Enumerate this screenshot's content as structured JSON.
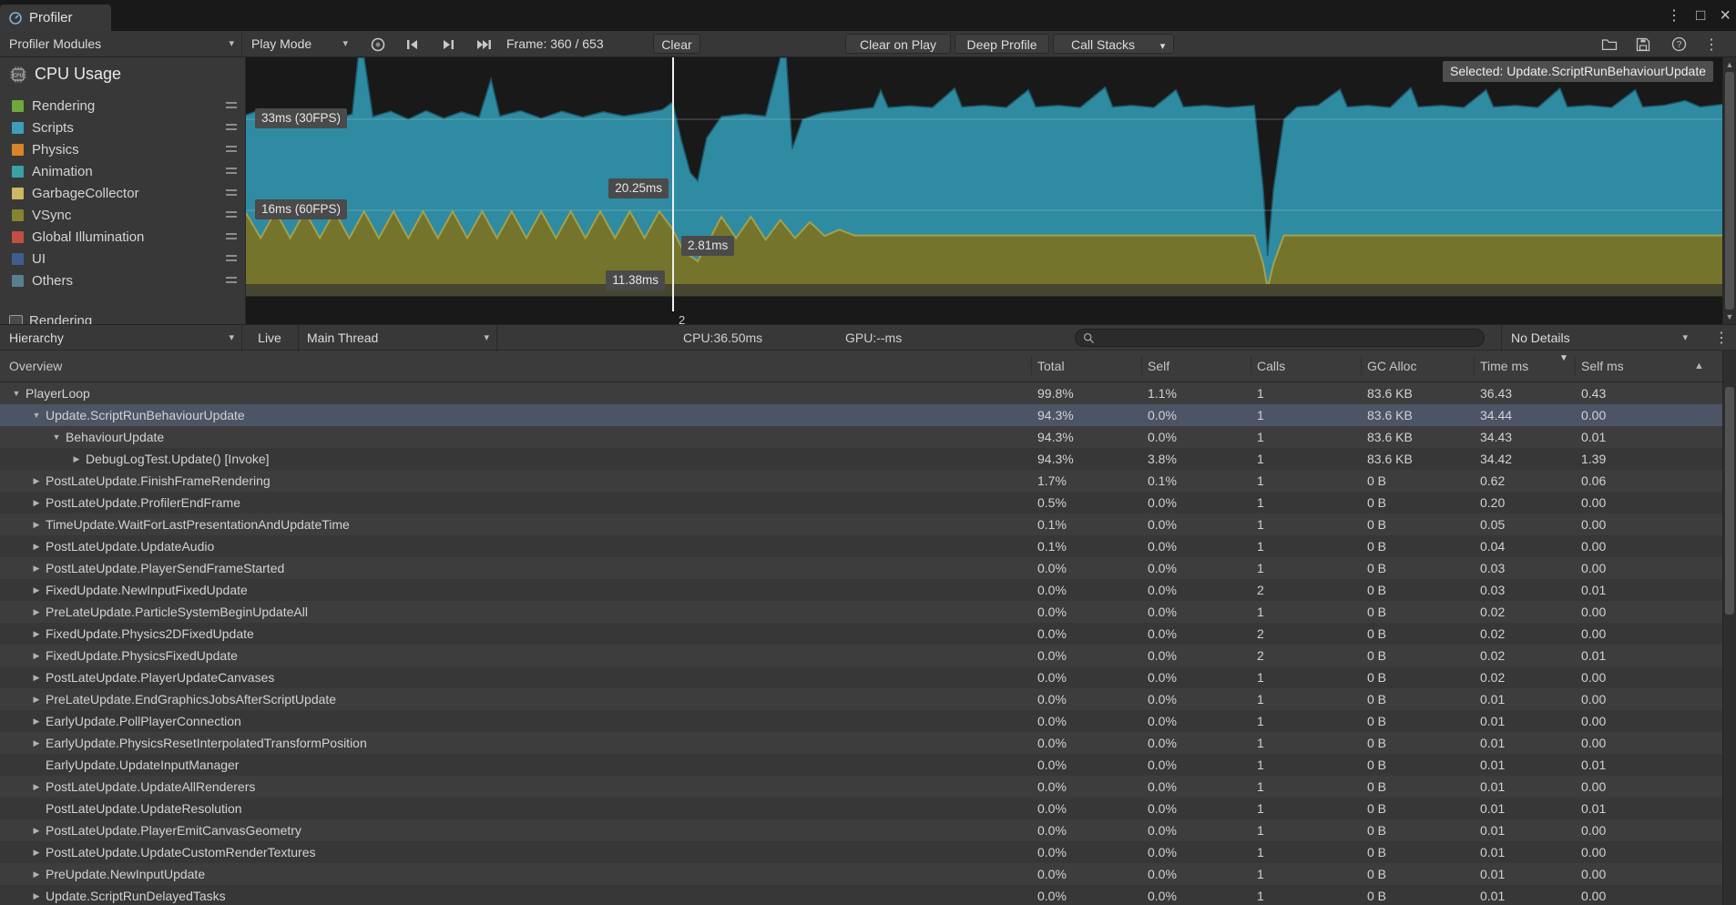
{
  "window": {
    "tab": "Profiler"
  },
  "icons": {
    "dropdown": "▾",
    "kebab": "⋮",
    "maximize": "□",
    "close": "×",
    "expanded": "▼",
    "collapsed": "▶",
    "sort_desc": "▼",
    "scroll_up": "▲",
    "scroll_down": "▼"
  },
  "toolbar": {
    "profiler_modules": "Profiler Modules",
    "play_mode": "Play Mode",
    "frame": "Frame: 360 / 653",
    "clear": "Clear",
    "clear_on_play": "Clear on Play",
    "deep_profile": "Deep Profile",
    "call_stacks": "Call Stacks"
  },
  "cpu_module": {
    "title": "CPU Usage",
    "legend": [
      {
        "label": "Rendering",
        "color": "#6fa83c"
      },
      {
        "label": "Scripts",
        "color": "#3d9fb5"
      },
      {
        "label": "Physics",
        "color": "#d8842a"
      },
      {
        "label": "Animation",
        "color": "#38a2a5"
      },
      {
        "label": "GarbageCollector",
        "color": "#cbb862"
      },
      {
        "label": "VSync",
        "color": "#85852f"
      },
      {
        "label": "Global Illumination",
        "color": "#c34e42"
      },
      {
        "label": "UI",
        "color": "#3f5e8d"
      },
      {
        "label": "Others",
        "color": "#57808f"
      }
    ],
    "next_module": {
      "label": "Rendering",
      "value": "2"
    }
  },
  "chart": {
    "selected_label": "Selected: Update.ScriptRunBehaviourUpdate",
    "label_33": "33ms (30FPS)",
    "label_16": "16ms (60FPS)",
    "marker_1": "20.25ms",
    "marker_2": "2.81ms",
    "marker_3": "11.38ms",
    "playhead_frac": 0.289,
    "colors": {
      "scripts": "#2f8ba1",
      "scripts_edge": "#1d5a6b",
      "vsync": "#74742c",
      "vsync_edge": "#a3a04b",
      "others_band": "#454531",
      "background": "#191919",
      "grid": "rgba(170,205,220,0.38)"
    },
    "total_pts": [
      [
        0,
        33.8
      ],
      [
        0.012,
        35.0
      ],
      [
        0.02,
        33.2
      ],
      [
        0.03,
        34.6
      ],
      [
        0.04,
        33.0
      ],
      [
        0.055,
        34.2
      ],
      [
        0.065,
        33.4
      ],
      [
        0.072,
        34.0
      ],
      [
        0.076,
        44.5
      ],
      [
        0.08,
        44.5
      ],
      [
        0.086,
        33.5
      ],
      [
        0.098,
        34.5
      ],
      [
        0.11,
        33.0
      ],
      [
        0.122,
        34.6
      ],
      [
        0.134,
        33.2
      ],
      [
        0.146,
        34.4
      ],
      [
        0.158,
        33.4
      ],
      [
        0.166,
        40.5
      ],
      [
        0.172,
        33.6
      ],
      [
        0.186,
        34.6
      ],
      [
        0.2,
        33.2
      ],
      [
        0.214,
        34.5
      ],
      [
        0.228,
        33.4
      ],
      [
        0.242,
        34.4
      ],
      [
        0.256,
        33.6
      ],
      [
        0.27,
        34.2
      ],
      [
        0.282,
        34.8
      ],
      [
        0.289,
        36.2
      ],
      [
        0.295,
        29.0
      ],
      [
        0.301,
        23.0
      ],
      [
        0.306,
        21.5
      ],
      [
        0.312,
        29.5
      ],
      [
        0.322,
        33.5
      ],
      [
        0.338,
        34.0
      ],
      [
        0.352,
        33.6
      ],
      [
        0.362,
        44.5
      ],
      [
        0.366,
        44.5
      ],
      [
        0.37,
        27.5
      ],
      [
        0.377,
        33.0
      ],
      [
        0.39,
        34.2
      ],
      [
        0.405,
        34.6
      ],
      [
        0.418,
        35.0
      ],
      [
        0.425,
        35.2
      ],
      [
        0.43,
        38.4
      ],
      [
        0.435,
        35.2
      ],
      [
        0.45,
        35.5
      ],
      [
        0.465,
        35.2
      ],
      [
        0.48,
        38.8
      ],
      [
        0.485,
        35.3
      ],
      [
        0.5,
        35.6
      ],
      [
        0.515,
        35.2
      ],
      [
        0.53,
        38.5
      ],
      [
        0.535,
        35.3
      ],
      [
        0.55,
        35.6
      ],
      [
        0.565,
        35.2
      ],
      [
        0.582,
        39.0
      ],
      [
        0.587,
        35.3
      ],
      [
        0.6,
        35.6
      ],
      [
        0.615,
        35.2
      ],
      [
        0.63,
        38.5
      ],
      [
        0.635,
        35.3
      ],
      [
        0.65,
        35.6
      ],
      [
        0.665,
        35.2
      ],
      [
        0.683,
        35.6
      ],
      [
        0.689,
        20.0
      ],
      [
        0.692,
        7.5
      ],
      [
        0.696,
        20.0
      ],
      [
        0.703,
        33.0
      ],
      [
        0.712,
        35.3
      ],
      [
        0.726,
        35.6
      ],
      [
        0.741,
        38.6
      ],
      [
        0.746,
        35.3
      ],
      [
        0.76,
        35.6
      ],
      [
        0.775,
        35.2
      ],
      [
        0.789,
        38.9
      ],
      [
        0.794,
        35.3
      ],
      [
        0.81,
        35.6
      ],
      [
        0.825,
        35.2
      ],
      [
        0.84,
        38.5
      ],
      [
        0.845,
        35.3
      ],
      [
        0.86,
        35.6
      ],
      [
        0.875,
        35.2
      ],
      [
        0.89,
        38.8
      ],
      [
        0.895,
        35.3
      ],
      [
        0.91,
        35.6
      ],
      [
        0.925,
        35.2
      ],
      [
        0.941,
        38.5
      ],
      [
        0.946,
        35.3
      ],
      [
        0.96,
        35.6
      ],
      [
        0.975,
        36.5
      ],
      [
        0.985,
        35.3
      ],
      [
        1,
        35.8
      ]
    ],
    "vsync_pts": [
      [
        0,
        15.5
      ],
      [
        0.01,
        10.8
      ],
      [
        0.02,
        15.8
      ],
      [
        0.03,
        10.8
      ],
      [
        0.04,
        15.8
      ],
      [
        0.05,
        10.8
      ],
      [
        0.06,
        15.8
      ],
      [
        0.07,
        10.8
      ],
      [
        0.08,
        15.8
      ],
      [
        0.09,
        10.8
      ],
      [
        0.1,
        15.8
      ],
      [
        0.11,
        10.8
      ],
      [
        0.12,
        15.8
      ],
      [
        0.13,
        10.8
      ],
      [
        0.14,
        15.8
      ],
      [
        0.15,
        10.8
      ],
      [
        0.16,
        15.8
      ],
      [
        0.17,
        10.8
      ],
      [
        0.18,
        15.8
      ],
      [
        0.19,
        10.8
      ],
      [
        0.2,
        15.8
      ],
      [
        0.21,
        10.8
      ],
      [
        0.22,
        15.8
      ],
      [
        0.23,
        10.8
      ],
      [
        0.24,
        15.8
      ],
      [
        0.25,
        10.8
      ],
      [
        0.26,
        15.8
      ],
      [
        0.27,
        10.8
      ],
      [
        0.28,
        15.8
      ],
      [
        0.289,
        12.5
      ],
      [
        0.296,
        8.5
      ],
      [
        0.306,
        6.5
      ],
      [
        0.314,
        10.5
      ],
      [
        0.322,
        14.8
      ],
      [
        0.332,
        10.8
      ],
      [
        0.342,
        14.8
      ],
      [
        0.352,
        10.5
      ],
      [
        0.362,
        14.2
      ],
      [
        0.372,
        10.8
      ],
      [
        0.382,
        13.8
      ],
      [
        0.392,
        11.2
      ],
      [
        0.402,
        12.4
      ],
      [
        0.412,
        11.3
      ],
      [
        0.683,
        11.3
      ],
      [
        0.689,
        6.0
      ],
      [
        0.692,
        1.5
      ],
      [
        0.696,
        6.0
      ],
      [
        0.703,
        11.3
      ],
      [
        1,
        11.3
      ]
    ]
  },
  "hierarchy_bar": {
    "mode": "Hierarchy",
    "live": "Live",
    "thread": "Main Thread",
    "cpu": "CPU:36.50ms",
    "gpu": "GPU:--ms",
    "search_value": "",
    "search_placeholder": "",
    "details": "No Details"
  },
  "table": {
    "columns": [
      "Overview",
      "Total",
      "Self",
      "Calls",
      "GC Alloc",
      "Time ms",
      "Self ms"
    ],
    "col_lefts": [
      1139,
      1260,
      1380,
      1501,
      1625,
      1736
    ],
    "sort_column": "Time ms",
    "rows": [
      {
        "name": "PlayerLoop",
        "depth": 0,
        "arrow": "down",
        "total": "99.8%",
        "self": "1.1%",
        "calls": "1",
        "gc": "83.6 KB",
        "time": "36.43",
        "self_ms": "0.43",
        "selected": false
      },
      {
        "name": "Update.ScriptRunBehaviourUpdate",
        "depth": 1,
        "arrow": "down",
        "total": "94.3%",
        "self": "0.0%",
        "calls": "1",
        "gc": "83.6 KB",
        "time": "34.44",
        "self_ms": "0.00",
        "selected": true
      },
      {
        "name": "BehaviourUpdate",
        "depth": 2,
        "arrow": "down",
        "total": "94.3%",
        "self": "0.0%",
        "calls": "1",
        "gc": "83.6 KB",
        "time": "34.43",
        "self_ms": "0.01",
        "selected": false
      },
      {
        "name": "DebugLogTest.Update() [Invoke]",
        "depth": 3,
        "arrow": "right",
        "total": "94.3%",
        "self": "3.8%",
        "calls": "1",
        "gc": "83.6 KB",
        "time": "34.42",
        "self_ms": "1.39",
        "selected": false
      },
      {
        "name": "PostLateUpdate.FinishFrameRendering",
        "depth": 1,
        "arrow": "right",
        "total": "1.7%",
        "self": "0.1%",
        "calls": "1",
        "gc": "0 B",
        "time": "0.62",
        "self_ms": "0.06",
        "selected": false
      },
      {
        "name": "PostLateUpdate.ProfilerEndFrame",
        "depth": 1,
        "arrow": "right",
        "total": "0.5%",
        "self": "0.0%",
        "calls": "1",
        "gc": "0 B",
        "time": "0.20",
        "self_ms": "0.00",
        "selected": false
      },
      {
        "name": "TimeUpdate.WaitForLastPresentationAndUpdateTime",
        "depth": 1,
        "arrow": "right",
        "total": "0.1%",
        "self": "0.0%",
        "calls": "1",
        "gc": "0 B",
        "time": "0.05",
        "self_ms": "0.00",
        "selected": false
      },
      {
        "name": "PostLateUpdate.UpdateAudio",
        "depth": 1,
        "arrow": "right",
        "total": "0.1%",
        "self": "0.0%",
        "calls": "1",
        "gc": "0 B",
        "time": "0.04",
        "self_ms": "0.00",
        "selected": false
      },
      {
        "name": "PostLateUpdate.PlayerSendFrameStarted",
        "depth": 1,
        "arrow": "right",
        "total": "0.0%",
        "self": "0.0%",
        "calls": "1",
        "gc": "0 B",
        "time": "0.03",
        "self_ms": "0.00",
        "selected": false
      },
      {
        "name": "FixedUpdate.NewInputFixedUpdate",
        "depth": 1,
        "arrow": "right",
        "total": "0.0%",
        "self": "0.0%",
        "calls": "2",
        "gc": "0 B",
        "time": "0.03",
        "self_ms": "0.01",
        "selected": false
      },
      {
        "name": "PreLateUpdate.ParticleSystemBeginUpdateAll",
        "depth": 1,
        "arrow": "right",
        "total": "0.0%",
        "self": "0.0%",
        "calls": "1",
        "gc": "0 B",
        "time": "0.02",
        "self_ms": "0.00",
        "selected": false
      },
      {
        "name": "FixedUpdate.Physics2DFixedUpdate",
        "depth": 1,
        "arrow": "right",
        "total": "0.0%",
        "self": "0.0%",
        "calls": "2",
        "gc": "0 B",
        "time": "0.02",
        "self_ms": "0.00",
        "selected": false
      },
      {
        "name": "FixedUpdate.PhysicsFixedUpdate",
        "depth": 1,
        "arrow": "right",
        "total": "0.0%",
        "self": "0.0%",
        "calls": "2",
        "gc": "0 B",
        "time": "0.02",
        "self_ms": "0.01",
        "selected": false
      },
      {
        "name": "PostLateUpdate.PlayerUpdateCanvases",
        "depth": 1,
        "arrow": "right",
        "total": "0.0%",
        "self": "0.0%",
        "calls": "1",
        "gc": "0 B",
        "time": "0.02",
        "self_ms": "0.00",
        "selected": false
      },
      {
        "name": "PreLateUpdate.EndGraphicsJobsAfterScriptUpdate",
        "depth": 1,
        "arrow": "right",
        "total": "0.0%",
        "self": "0.0%",
        "calls": "1",
        "gc": "0 B",
        "time": "0.01",
        "self_ms": "0.00",
        "selected": false
      },
      {
        "name": "EarlyUpdate.PollPlayerConnection",
        "depth": 1,
        "arrow": "right",
        "total": "0.0%",
        "self": "0.0%",
        "calls": "1",
        "gc": "0 B",
        "time": "0.01",
        "self_ms": "0.00",
        "selected": false
      },
      {
        "name": "EarlyUpdate.PhysicsResetInterpolatedTransformPosition",
        "depth": 1,
        "arrow": "right",
        "total": "0.0%",
        "self": "0.0%",
        "calls": "1",
        "gc": "0 B",
        "time": "0.01",
        "self_ms": "0.00",
        "selected": false
      },
      {
        "name": "EarlyUpdate.UpdateInputManager",
        "depth": 1,
        "arrow": "none",
        "total": "0.0%",
        "self": "0.0%",
        "calls": "1",
        "gc": "0 B",
        "time": "0.01",
        "self_ms": "0.01",
        "selected": false
      },
      {
        "name": "PostLateUpdate.UpdateAllRenderers",
        "depth": 1,
        "arrow": "right",
        "total": "0.0%",
        "self": "0.0%",
        "calls": "1",
        "gc": "0 B",
        "time": "0.01",
        "self_ms": "0.00",
        "selected": false
      },
      {
        "name": "PostLateUpdate.UpdateResolution",
        "depth": 1,
        "arrow": "none",
        "total": "0.0%",
        "self": "0.0%",
        "calls": "1",
        "gc": "0 B",
        "time": "0.01",
        "self_ms": "0.01",
        "selected": false
      },
      {
        "name": "PostLateUpdate.PlayerEmitCanvasGeometry",
        "depth": 1,
        "arrow": "right",
        "total": "0.0%",
        "self": "0.0%",
        "calls": "1",
        "gc": "0 B",
        "time": "0.01",
        "self_ms": "0.00",
        "selected": false
      },
      {
        "name": "PostLateUpdate.UpdateCustomRenderTextures",
        "depth": 1,
        "arrow": "right",
        "total": "0.0%",
        "self": "0.0%",
        "calls": "1",
        "gc": "0 B",
        "time": "0.01",
        "self_ms": "0.00",
        "selected": false
      },
      {
        "name": "PreUpdate.NewInputUpdate",
        "depth": 1,
        "arrow": "right",
        "total": "0.0%",
        "self": "0.0%",
        "calls": "1",
        "gc": "0 B",
        "time": "0.01",
        "self_ms": "0.00",
        "selected": false
      },
      {
        "name": "Update.ScriptRunDelayedTasks",
        "depth": 1,
        "arrow": "right",
        "total": "0.0%",
        "self": "0.0%",
        "calls": "1",
        "gc": "0 B",
        "time": "0.01",
        "self_ms": "0.00",
        "selected": false
      }
    ]
  }
}
